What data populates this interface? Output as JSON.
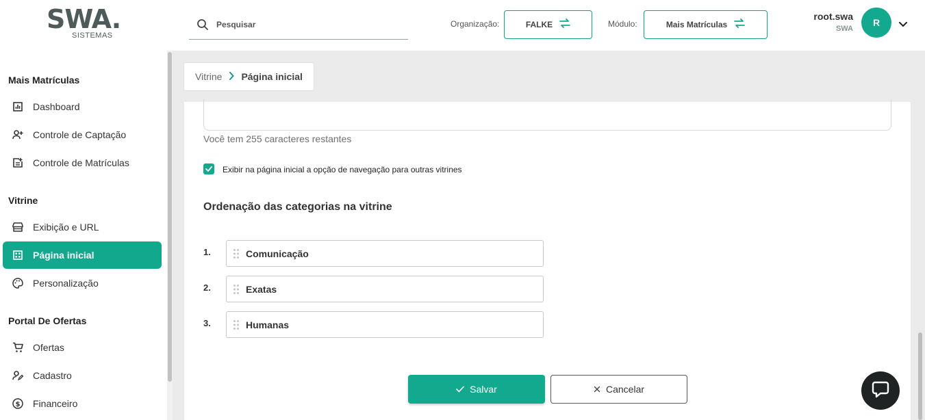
{
  "header": {
    "logo": "SWA.",
    "logo_sub": "SISTEMAS",
    "search_placeholder": "Pesquisar",
    "org_label": "Organização:",
    "org_value": "FALKE",
    "module_label": "Módulo:",
    "module_value": "Mais Matrículas",
    "user_name": "root.swa",
    "user_org": "SWA",
    "avatar_initial": "R"
  },
  "sidebar": {
    "sections": [
      {
        "title": "Mais Matrículas",
        "items": [
          {
            "label": "Dashboard",
            "icon": "chart-icon"
          },
          {
            "label": "Controle de Captação",
            "icon": "person-add-icon"
          },
          {
            "label": "Controle de Matrículas",
            "icon": "document-add-icon"
          }
        ]
      },
      {
        "title": "Vitrine",
        "items": [
          {
            "label": "Exibição e URL",
            "icon": "storefront-icon"
          },
          {
            "label": "Página inicial",
            "icon": "grid-page-icon",
            "active": true
          },
          {
            "label": "Personalização",
            "icon": "palette-icon"
          }
        ]
      },
      {
        "title": "Portal De Ofertas",
        "items": [
          {
            "label": "Ofertas",
            "icon": "cart-icon"
          },
          {
            "label": "Cadastro",
            "icon": "person-edit-icon"
          },
          {
            "label": "Financeiro",
            "icon": "dollar-circle-icon"
          }
        ]
      }
    ]
  },
  "breadcrumb": {
    "items": [
      "Vitrine",
      "Página inicial"
    ]
  },
  "form": {
    "chars_left": "Você tem 255 caracteres restantes",
    "checkbox_label": "Exibir na página inicial a opção de navegação para outras vitrines",
    "checkbox_checked": true,
    "order_title": "Ordenação das categorias na vitrine",
    "categories": [
      {
        "num": "1.",
        "name": "Comunicação"
      },
      {
        "num": "2.",
        "name": "Exatas"
      },
      {
        "num": "3.",
        "name": "Humanas"
      }
    ],
    "save_label": "Salvar",
    "cancel_label": "Cancelar"
  },
  "colors": {
    "accent": "#13a98f",
    "chat_button": "#1f2323"
  }
}
